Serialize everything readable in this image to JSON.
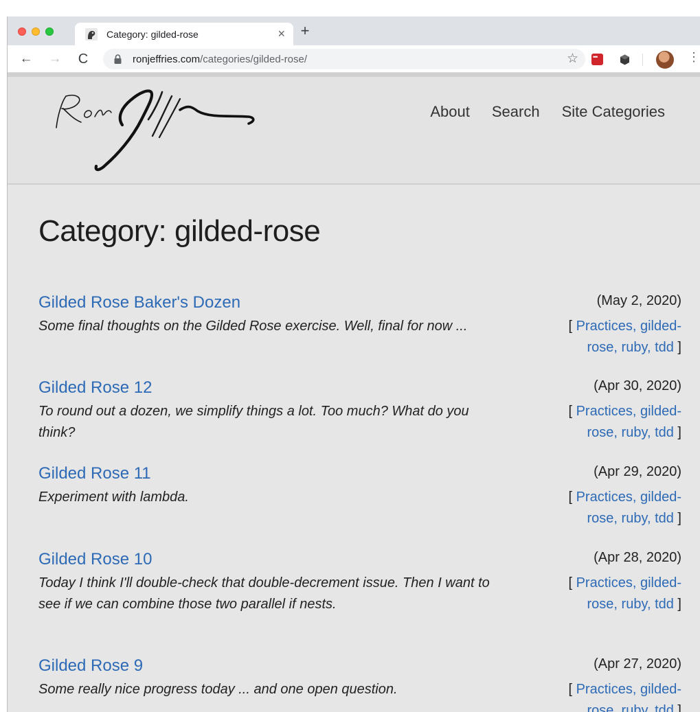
{
  "browser": {
    "tab_title": "Category: gilded-rose",
    "close_glyph": "×",
    "new_tab_glyph": "+",
    "back_glyph": "←",
    "forward_glyph": "→",
    "reload_glyph": "C",
    "url_host": "ronjeffries.com",
    "url_path": "/categories/gilded-rose/",
    "bookmark_glyph": "☆",
    "menu_glyph": "⋮",
    "icons": [
      "favicon-icon",
      "lock-icon",
      "star-icon",
      "extension-red-icon",
      "extension-cube-icon",
      "profile-avatar",
      "kebab-menu-icon"
    ]
  },
  "site": {
    "nav": [
      "About",
      "Search",
      "Site Categories"
    ]
  },
  "page": {
    "title": "Category: gilded-rose",
    "posts": [
      {
        "title": "Gilded Rose Baker's Dozen",
        "summary": "Some final thoughts on the Gilded Rose exercise. Well, final for now ...",
        "date": "(May 2, 2020)",
        "cats_open": "[ ",
        "cats_line1": "Practices, gilded-",
        "cats_line2": "rose, ruby, tdd",
        "cats_close": " ]"
      },
      {
        "title": "Gilded Rose 12",
        "summary": "To round out a dozen, we simplify things a lot. Too much? What do you think?",
        "date": "(Apr 30, 2020)",
        "cats_open": "[ ",
        "cats_line1": "Practices, gilded-",
        "cats_line2": "rose, ruby, tdd",
        "cats_close": " ]"
      },
      {
        "title": "Gilded Rose 11",
        "summary": "Experiment with lambda.",
        "date": "(Apr 29, 2020)",
        "cats_open": "[ ",
        "cats_line1": "Practices, gilded-",
        "cats_line2": "rose, ruby, tdd",
        "cats_close": " ]"
      },
      {
        "title": "Gilded Rose 10",
        "summary": "Today I think I'll double-check that double-decrement issue. Then I want to see if we can combine those two parallel if nests.",
        "date": "(Apr 28, 2020)",
        "cats_open": "[ ",
        "cats_line1": "Practices, gilded-",
        "cats_line2": "rose, ruby, tdd",
        "cats_close": " ]"
      },
      {
        "title": "Gilded Rose 9",
        "summary": "Some really nice progress today ... and one open question.",
        "date": "(Apr 27, 2020)",
        "cats_open": "[ ",
        "cats_line1": "Practices, gilded-",
        "cats_line2": "rose, ruby, tdd",
        "cats_close": " ]"
      }
    ]
  },
  "colors": {
    "link": "#2d6ab6",
    "page_bg": "#e6e6e6",
    "header_bg": "#e3e3e3",
    "text": "#222222"
  }
}
